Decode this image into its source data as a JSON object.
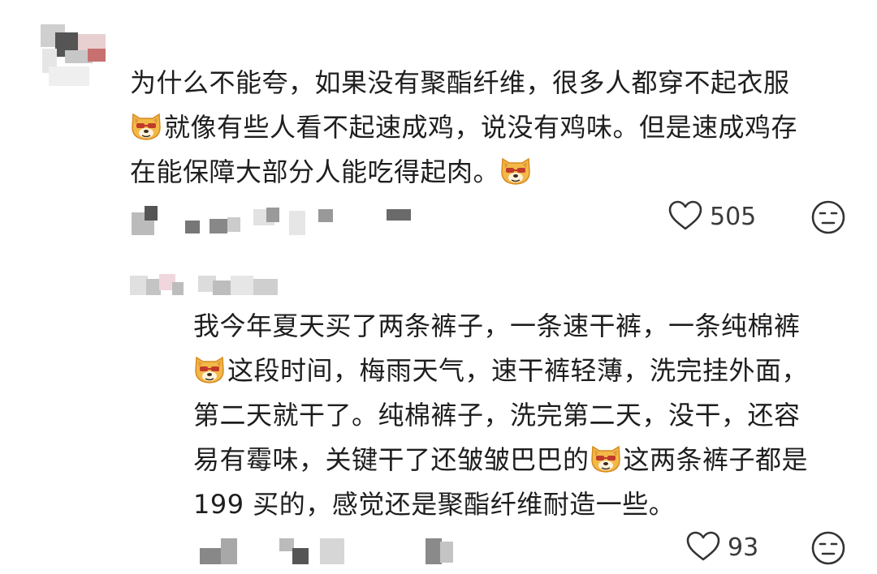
{
  "comments": [
    {
      "lines": [
        {
          "pre_emoji": false,
          "text": "为什么不能夸，如果没有聚酯纤维，很多人都穿不起衣服"
        },
        {
          "pre_emoji": true,
          "text": "就像有些人看不起速成鸡，说没有鸡味。但是速成鸡存"
        },
        {
          "pre_emoji": false,
          "text": "在能保障大部分人能吃得起肉。",
          "post_emoji": true
        }
      ],
      "likes": "505",
      "emoji_icon": "dog-face-emoji-icon"
    },
    {
      "lines": [
        {
          "text": "我今年夏天买了两条裤子，一条速干裤，一条纯棉裤"
        },
        {
          "pre_emoji": true,
          "text": "这段时间，梅雨天气，速干裤轻薄，洗完挂外面，"
        },
        {
          "text": "第二天就干了。纯棉裤子，洗完第二天，没干，还容"
        },
        {
          "text_a": "易有霉味，关键干了还皱皱巴巴的",
          "text_b": "这两条裤子都是"
        },
        {
          "text": "199 买的，感觉还是聚酯纤维耐造一些。"
        }
      ],
      "likes": "93",
      "emoji_icon": "dog-face-emoji-icon"
    }
  ],
  "icons": {
    "like": "heart-outline-icon",
    "reaction": "neutral-face-icon"
  },
  "colors": {
    "text": "#1e1e1e",
    "meta": "#3a3a3a",
    "pixelated_light": "#d9d9d9",
    "pixelated_dark": "#8a8a8a",
    "emoji_fill": "#f3b948",
    "emoji_glasses": "#c0392b"
  }
}
